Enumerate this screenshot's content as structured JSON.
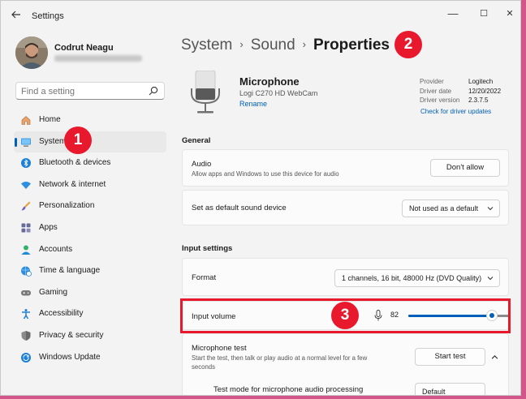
{
  "window": {
    "title": "Settings",
    "minimize": "—",
    "maximize": "☐",
    "close": "✕"
  },
  "user": {
    "name": "Codrut Neagu"
  },
  "search": {
    "placeholder": "Find a setting"
  },
  "sidebar": {
    "items": [
      {
        "label": "Home",
        "icon": "home-icon"
      },
      {
        "label": "System",
        "icon": "system-icon",
        "active": true
      },
      {
        "label": "Bluetooth & devices",
        "icon": "bluetooth-icon"
      },
      {
        "label": "Network & internet",
        "icon": "wifi-icon"
      },
      {
        "label": "Personalization",
        "icon": "brush-icon"
      },
      {
        "label": "Apps",
        "icon": "apps-icon"
      },
      {
        "label": "Accounts",
        "icon": "accounts-icon"
      },
      {
        "label": "Time & language",
        "icon": "globe-clock-icon"
      },
      {
        "label": "Gaming",
        "icon": "gamepad-icon"
      },
      {
        "label": "Accessibility",
        "icon": "accessibility-icon"
      },
      {
        "label": "Privacy & security",
        "icon": "shield-icon"
      },
      {
        "label": "Windows Update",
        "icon": "update-icon"
      }
    ]
  },
  "breadcrumb": {
    "items": [
      "System",
      "Sound"
    ],
    "separator": "›",
    "current": "Properties"
  },
  "device": {
    "name": "Microphone",
    "model": "Logi C270 HD WebCam",
    "rename": "Rename",
    "driver": {
      "provider_label": "Provider",
      "provider": "Logitech",
      "date_label": "Driver date",
      "date": "12/20/2022",
      "version_label": "Driver version",
      "version": "2.3.7.5",
      "check_link": "Check for driver updates"
    }
  },
  "general": {
    "title": "General",
    "audio": {
      "title": "Audio",
      "subtitle": "Allow apps and Windows to use this device for audio",
      "button": "Don't allow"
    },
    "default_device": {
      "title": "Set as default sound device",
      "value": "Not used as a default"
    }
  },
  "input_settings": {
    "title": "Input settings",
    "format": {
      "title": "Format",
      "value": "1 channels, 16 bit, 48000 Hz (DVD Quality)"
    },
    "volume": {
      "title": "Input volume",
      "value": "82",
      "level": 82
    },
    "mic_test": {
      "title": "Microphone test",
      "subtitle": "Start the test, then talk or play audio at a normal level for a few seconds",
      "button": "Start test"
    },
    "test_mode": {
      "title": "Test mode for microphone audio processing",
      "value": "Default"
    }
  },
  "annotations": {
    "one": "1",
    "two": "2",
    "three": "3"
  },
  "colors": {
    "accent": "#005fb8",
    "highlight": "#e8192c",
    "background": "#f3f3f3"
  }
}
